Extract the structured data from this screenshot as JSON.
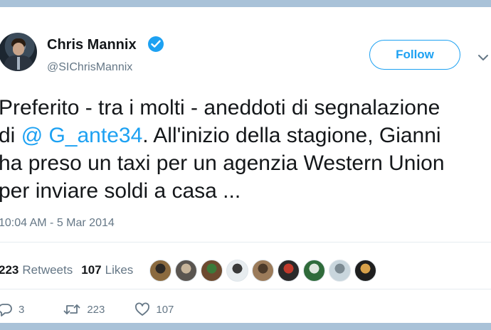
{
  "author": {
    "name": "Chris Mannix",
    "handle": "@SIChrisMannix",
    "verified_icon": "verified-badge-icon"
  },
  "follow_button": {
    "label": "Follow"
  },
  "tweet": {
    "line1": "Preferito - tra i molti - aneddoti di segnalazione",
    "line2_prefix": "di ",
    "mention": "@ G_ante34",
    "line2_suffix": ". All'inizio della stagione, Gianni",
    "line3": "ha preso un taxi per un agenzia Western Union",
    "line4": "per inviare soldi a casa ..."
  },
  "timestamp": "10:04 AM - 5 Mar 2014",
  "stats": {
    "retweets_count": "223",
    "retweets_label": "Retweets",
    "likes_count": "107",
    "likes_label": "Likes"
  },
  "likers": [
    {
      "color": "#8b6a3e",
      "accent": "#2e2a25"
    },
    {
      "color": "#5a5550",
      "accent": "#c7b49a"
    },
    {
      "color": "#6d4a2f",
      "accent": "#3b7b3a"
    },
    {
      "color": "#e7ecef",
      "accent": "#3a3a3a"
    },
    {
      "color": "#9b7b5a",
      "accent": "#4b3a2a"
    },
    {
      "color": "#2a2a2a",
      "accent": "#c0392b"
    },
    {
      "color": "#2f6b3a",
      "accent": "#dfe7de"
    },
    {
      "color": "#c9d6dd",
      "accent": "#7c8a92"
    },
    {
      "color": "#1f1f1f",
      "accent": "#d8a14a"
    }
  ],
  "actions": {
    "reply_count": "3",
    "retweet_count": "223",
    "like_count": "107"
  },
  "colors": {
    "accent": "#1da1f2",
    "muted": "#657786",
    "frame": "#a9c2d8"
  }
}
